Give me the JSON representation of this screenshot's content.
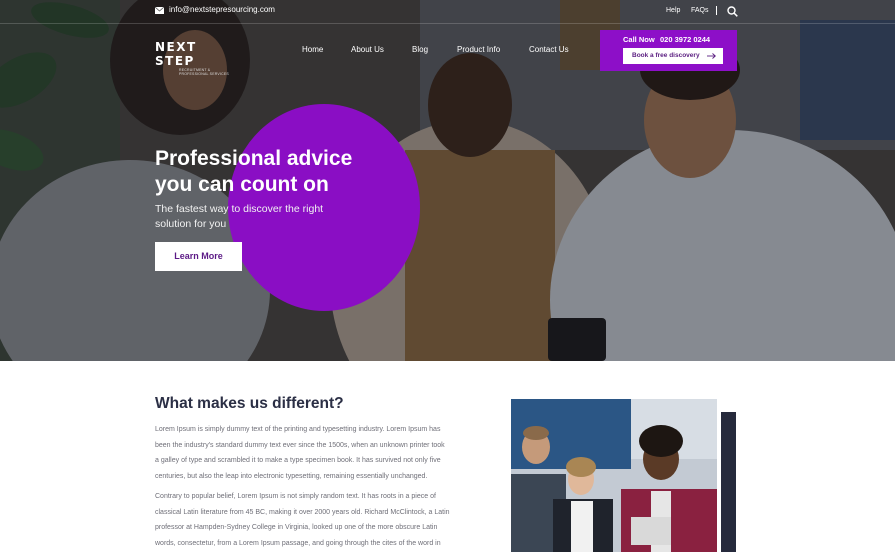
{
  "topbar": {
    "email": "info@nextstepresourcing.com",
    "help": "Help",
    "faqs": "FAQs",
    "icons": [
      "mail-icon",
      "search-icon"
    ]
  },
  "brand": {
    "logo_text": "NEXT STEP",
    "logo_tagline": "RECRUITMENT & PROFESSIONAL SERVICES"
  },
  "nav": {
    "items": [
      "Home",
      "About Us",
      "Blog",
      "Product Info",
      "Contact Us"
    ]
  },
  "cta": {
    "call_label": "Call Now",
    "phone": "020 3972 0244",
    "button_label": "Book a free discovery"
  },
  "hero": {
    "title_line1": "Professional advice",
    "title_line2": "you can count on",
    "subtitle_line1": "The fastest way to discover the right",
    "subtitle_line2": "solution for you",
    "button_label": "Learn More"
  },
  "content": {
    "heading": "What makes us different?",
    "paragraph1_lines": [
      "Lorem Ipsum is simply dummy text of the printing and typesetting industry. Lorem Ipsum has",
      "been the industry's standard dummy text ever since the 1500s, when an unknown printer took",
      "a galley of type and scrambled it to make a type specimen book. It has survived not only five",
      "centuries, but also the leap into electronic typesetting, remaining essentially unchanged."
    ],
    "paragraph2_lines": [
      "Contrary to popular belief, Lorem Ipsum is not simply random text. It has roots in a piece of",
      "classical Latin literature from 45 BC, making it over 2000 years old. Richard McClintock, a Latin",
      "professor at Hampden-Sydney College in Virginia, looked up one of the more obscure Latin",
      "words, consectetur, from a Lorem Ipsum passage, and going through the cites of the word in"
    ]
  },
  "colors": {
    "accent_purple": "#8a0ec4",
    "dark_navy": "#262a3c",
    "heading": "#2b2f45"
  }
}
